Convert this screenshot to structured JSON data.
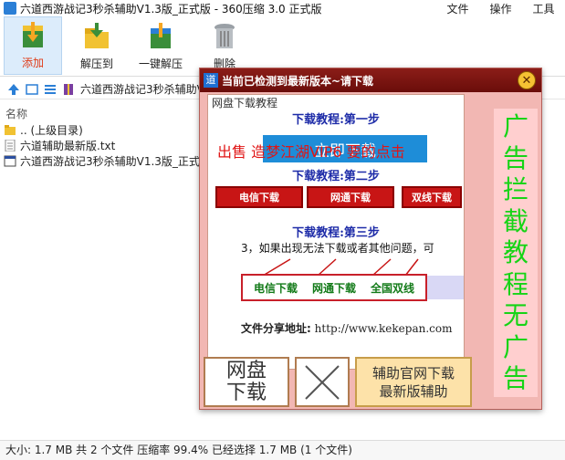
{
  "window": {
    "title": "六道西游战记3秒杀辅助V1.3版_正式版 - 360压缩 3.0 正式版"
  },
  "menus": [
    "文件",
    "操作",
    "工具"
  ],
  "toolbar": [
    {
      "label": "添加",
      "icon": "add-archive-icon",
      "active": true
    },
    {
      "label": "解压到",
      "icon": "extract-to-icon",
      "active": false
    },
    {
      "label": "一键解压",
      "icon": "one-click-extract-icon",
      "active": false
    },
    {
      "label": "删除",
      "icon": "trash-icon",
      "active": false
    }
  ],
  "pathbar": {
    "path": "六道西游战记3秒杀辅助V1.3版_正式版.zip - 解包大小为 1.7 MB"
  },
  "list": {
    "header": "名称",
    "rows": [
      {
        "name": ".. (上级目录)",
        "icon": "folder-icon"
      },
      {
        "name": "六道辅助最新版.txt",
        "icon": "text-file-icon"
      },
      {
        "name": "六道西游战记3秒杀辅助V1.3版_正式版",
        "icon": "exe-file-icon"
      }
    ]
  },
  "statusbar": {
    "text": "大小: 1.7 MB 共 2 个文件 压缩率 99.4% 已经选择 1.7 MB (1 个文件)"
  },
  "popup": {
    "title": "当前已检测到最新版本~请下载",
    "caption": "网盘下载教程",
    "step1": "下载教程:第一步",
    "step1_button": "立即下载",
    "overlay_text": "出售 造梦江湖VIP6 要的点击",
    "step2": "下载教程:第二步",
    "step2_buttons": [
      "电信下载",
      "网通下载",
      "双线下载"
    ],
    "step3": "下载教程:第三步",
    "step3_line": "3，如果出现无法下载或者其他问题，可",
    "step3_options": [
      "电信下载",
      "网通下载",
      "全国双线"
    ],
    "share_label": "文件分享地址:",
    "share_url": "http://www.kekepan.com",
    "ad_text": [
      "广",
      "告",
      "拦",
      "截",
      "教",
      "程",
      "无",
      "广",
      "告"
    ],
    "btn_netdisk": [
      "网盘",
      "下载"
    ],
    "btn_official": [
      "辅助官网下载",
      "最新版辅助"
    ]
  }
}
